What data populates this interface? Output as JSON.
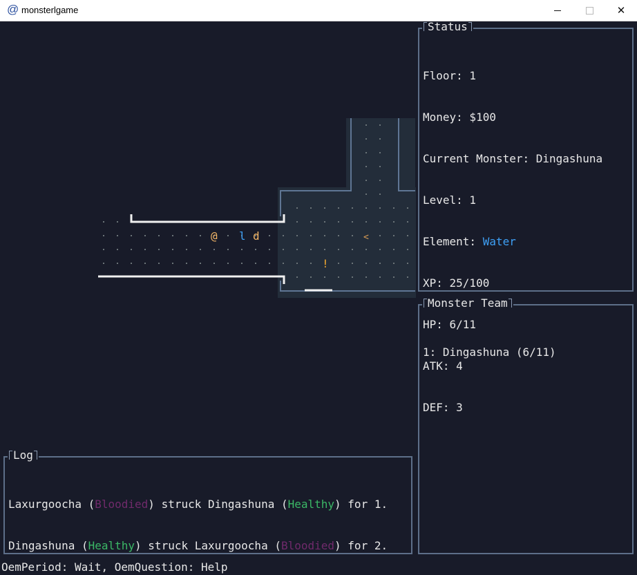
{
  "window": {
    "icon": "@",
    "title": "monsterlgame",
    "controls": {
      "minimize": "minimize-icon",
      "maximize": "maximize-icon",
      "close": "close-icon"
    }
  },
  "map": {
    "player": "@",
    "monsters": [
      "l",
      "d"
    ],
    "stairs": "<",
    "item": "!"
  },
  "status": {
    "title": "Status",
    "floor": "Floor: 1",
    "money": "Money: $100",
    "current_monster": "Current Monster: Dingashuna",
    "level": "Level: 1",
    "element_label": "Element: ",
    "element_value": "Water",
    "xp": "XP: 25/100",
    "hp": "HP: 6/11",
    "atk": "ATK: 4",
    "def": "DEF: 3"
  },
  "team": {
    "title": "Monster Team",
    "entries": [
      "1: Dingashuna (6/11)"
    ]
  },
  "log": {
    "title": "Log",
    "entries": [
      {
        "attacker": "Laxurgoocha",
        "attacker_state": "Bloodied",
        "verb": "struck",
        "target": "Dingashuna",
        "target_state": "Healthy",
        "suffix": "for 1."
      },
      {
        "attacker": "Dingashuna",
        "attacker_state": "Healthy",
        "verb": "struck",
        "target": "Laxurgoocha",
        "target_state": "Bloodied",
        "suffix": "for 2."
      }
    ]
  },
  "help_bar": "OemPeriod: Wait, OemQuestion: Help",
  "colors": {
    "background": "#181b29",
    "panel_border": "#5d6f89",
    "water": "#3ea0f5",
    "bloodied": "#702a6b",
    "healthy": "#3bb866",
    "player": "#f2b566",
    "monster_l": "#3ea0f5",
    "monster_d": "#f2b566",
    "stairs": "#d49a54",
    "item": "#f0a830"
  }
}
